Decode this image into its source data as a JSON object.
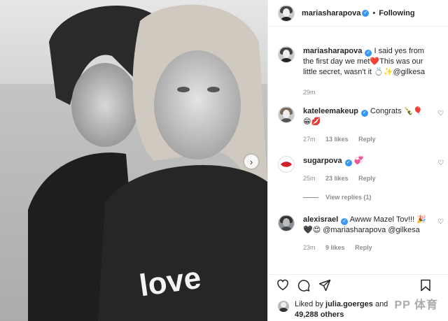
{
  "post": {
    "author": "mariasharapova",
    "follow_status": "Following",
    "separator": "•",
    "photo_text": "love"
  },
  "caption": {
    "user": "mariasharapova",
    "text": "I said yes from the first day we met❤️This was our little secret, wasn't it 💍✨@gilkesa",
    "time": "29m"
  },
  "comments": [
    {
      "user": "kateleemakeup",
      "text": "Congrats 🍾🎈 😁💋",
      "time": "27m",
      "likes": "13 likes",
      "reply": "Reply"
    },
    {
      "user": "sugarpova",
      "text": "💞",
      "time": "25m",
      "likes": "23 likes",
      "reply": "Reply"
    },
    {
      "user": "alexisrael",
      "text": "Awww Mazel Tov!!! 🎉🖤😍 @mariasharapova @gilkesa",
      "time": "23m",
      "likes": "9 likes",
      "reply": "Reply"
    }
  ],
  "view_replies": "View replies (1)",
  "footer": {
    "liked_by_prefix": "Liked by ",
    "liked_by_user": "julia.goerges",
    "liked_by_suffix": " and",
    "like_count": "49,288 others"
  },
  "watermark": "PP 体育",
  "icons": [
    "verified-icon",
    "heart-icon",
    "comment-icon",
    "share-icon",
    "bookmark-icon",
    "chevron-right-icon"
  ]
}
